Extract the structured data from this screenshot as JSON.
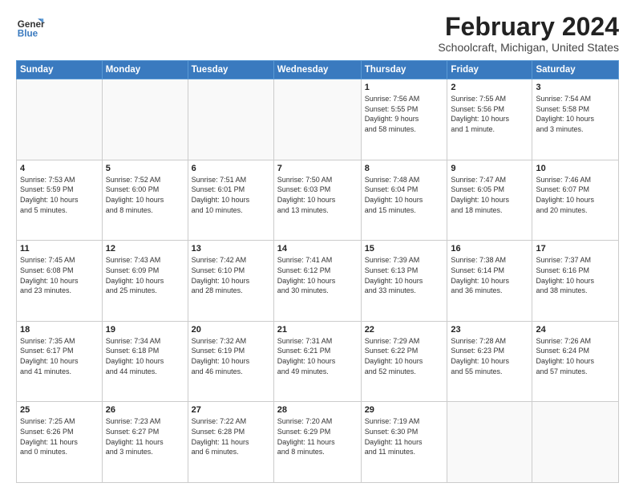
{
  "header": {
    "logo_line1": "General",
    "logo_line2": "Blue",
    "title": "February 2024",
    "subtitle": "Schoolcraft, Michigan, United States"
  },
  "columns": [
    "Sunday",
    "Monday",
    "Tuesday",
    "Wednesday",
    "Thursday",
    "Friday",
    "Saturday"
  ],
  "weeks": [
    [
      {
        "day": "",
        "info": ""
      },
      {
        "day": "",
        "info": ""
      },
      {
        "day": "",
        "info": ""
      },
      {
        "day": "",
        "info": ""
      },
      {
        "day": "1",
        "info": "Sunrise: 7:56 AM\nSunset: 5:55 PM\nDaylight: 9 hours\nand 58 minutes."
      },
      {
        "day": "2",
        "info": "Sunrise: 7:55 AM\nSunset: 5:56 PM\nDaylight: 10 hours\nand 1 minute."
      },
      {
        "day": "3",
        "info": "Sunrise: 7:54 AM\nSunset: 5:58 PM\nDaylight: 10 hours\nand 3 minutes."
      }
    ],
    [
      {
        "day": "4",
        "info": "Sunrise: 7:53 AM\nSunset: 5:59 PM\nDaylight: 10 hours\nand 5 minutes."
      },
      {
        "day": "5",
        "info": "Sunrise: 7:52 AM\nSunset: 6:00 PM\nDaylight: 10 hours\nand 8 minutes."
      },
      {
        "day": "6",
        "info": "Sunrise: 7:51 AM\nSunset: 6:01 PM\nDaylight: 10 hours\nand 10 minutes."
      },
      {
        "day": "7",
        "info": "Sunrise: 7:50 AM\nSunset: 6:03 PM\nDaylight: 10 hours\nand 13 minutes."
      },
      {
        "day": "8",
        "info": "Sunrise: 7:48 AM\nSunset: 6:04 PM\nDaylight: 10 hours\nand 15 minutes."
      },
      {
        "day": "9",
        "info": "Sunrise: 7:47 AM\nSunset: 6:05 PM\nDaylight: 10 hours\nand 18 minutes."
      },
      {
        "day": "10",
        "info": "Sunrise: 7:46 AM\nSunset: 6:07 PM\nDaylight: 10 hours\nand 20 minutes."
      }
    ],
    [
      {
        "day": "11",
        "info": "Sunrise: 7:45 AM\nSunset: 6:08 PM\nDaylight: 10 hours\nand 23 minutes."
      },
      {
        "day": "12",
        "info": "Sunrise: 7:43 AM\nSunset: 6:09 PM\nDaylight: 10 hours\nand 25 minutes."
      },
      {
        "day": "13",
        "info": "Sunrise: 7:42 AM\nSunset: 6:10 PM\nDaylight: 10 hours\nand 28 minutes."
      },
      {
        "day": "14",
        "info": "Sunrise: 7:41 AM\nSunset: 6:12 PM\nDaylight: 10 hours\nand 30 minutes."
      },
      {
        "day": "15",
        "info": "Sunrise: 7:39 AM\nSunset: 6:13 PM\nDaylight: 10 hours\nand 33 minutes."
      },
      {
        "day": "16",
        "info": "Sunrise: 7:38 AM\nSunset: 6:14 PM\nDaylight: 10 hours\nand 36 minutes."
      },
      {
        "day": "17",
        "info": "Sunrise: 7:37 AM\nSunset: 6:16 PM\nDaylight: 10 hours\nand 38 minutes."
      }
    ],
    [
      {
        "day": "18",
        "info": "Sunrise: 7:35 AM\nSunset: 6:17 PM\nDaylight: 10 hours\nand 41 minutes."
      },
      {
        "day": "19",
        "info": "Sunrise: 7:34 AM\nSunset: 6:18 PM\nDaylight: 10 hours\nand 44 minutes."
      },
      {
        "day": "20",
        "info": "Sunrise: 7:32 AM\nSunset: 6:19 PM\nDaylight: 10 hours\nand 46 minutes."
      },
      {
        "day": "21",
        "info": "Sunrise: 7:31 AM\nSunset: 6:21 PM\nDaylight: 10 hours\nand 49 minutes."
      },
      {
        "day": "22",
        "info": "Sunrise: 7:29 AM\nSunset: 6:22 PM\nDaylight: 10 hours\nand 52 minutes."
      },
      {
        "day": "23",
        "info": "Sunrise: 7:28 AM\nSunset: 6:23 PM\nDaylight: 10 hours\nand 55 minutes."
      },
      {
        "day": "24",
        "info": "Sunrise: 7:26 AM\nSunset: 6:24 PM\nDaylight: 10 hours\nand 57 minutes."
      }
    ],
    [
      {
        "day": "25",
        "info": "Sunrise: 7:25 AM\nSunset: 6:26 PM\nDaylight: 11 hours\nand 0 minutes."
      },
      {
        "day": "26",
        "info": "Sunrise: 7:23 AM\nSunset: 6:27 PM\nDaylight: 11 hours\nand 3 minutes."
      },
      {
        "day": "27",
        "info": "Sunrise: 7:22 AM\nSunset: 6:28 PM\nDaylight: 11 hours\nand 6 minutes."
      },
      {
        "day": "28",
        "info": "Sunrise: 7:20 AM\nSunset: 6:29 PM\nDaylight: 11 hours\nand 8 minutes."
      },
      {
        "day": "29",
        "info": "Sunrise: 7:19 AM\nSunset: 6:30 PM\nDaylight: 11 hours\nand 11 minutes."
      },
      {
        "day": "",
        "info": ""
      },
      {
        "day": "",
        "info": ""
      }
    ]
  ]
}
